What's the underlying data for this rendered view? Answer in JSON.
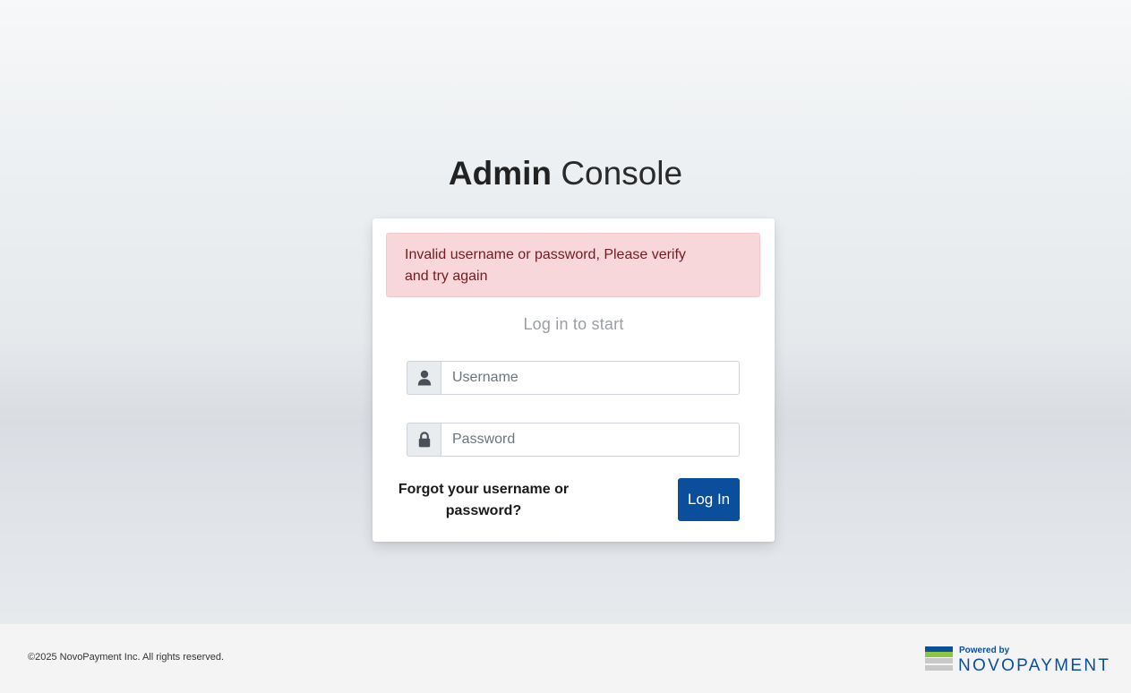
{
  "page": {
    "title_bold": "Admin",
    "title_light": "Console"
  },
  "alert": {
    "message": "Invalid username or password, Please verify and try again"
  },
  "form": {
    "subtitle": "Log in to start",
    "username_placeholder": "Username",
    "username_value": "",
    "password_placeholder": "Password",
    "password_value": "",
    "forgot_link": "Forgot your username or password?",
    "login_button": "Log In"
  },
  "footer": {
    "copyright": "©2025 NovoPayment Inc. All rights reserved.",
    "powered_by": "Powered by",
    "brand_name": "NOVOPAYMENT"
  },
  "icons": {
    "username": "user-icon",
    "password": "lock-icon"
  },
  "colors": {
    "primary": "#0b4f9c",
    "alert_bg": "#f8d7da",
    "alert_text": "#721c24",
    "brand_blue": "#0a4f9c",
    "brand_green": "#8cc63f",
    "brand_gray": "#c8c8c8"
  }
}
